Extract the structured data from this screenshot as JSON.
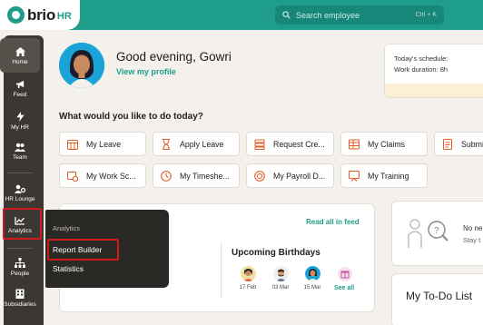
{
  "brand": {
    "name": "brio",
    "suffix": "HR",
    "color": "#1e9e8a"
  },
  "search": {
    "placeholder": "Search employee",
    "shortcut": "Ctrl + K"
  },
  "sidebar": {
    "items": [
      {
        "label": "Home",
        "icon": "home-icon",
        "active": true
      },
      {
        "label": "Feed",
        "icon": "megaphone-icon"
      },
      {
        "label": "My HR",
        "icon": "lightning-icon"
      },
      {
        "label": "Team",
        "icon": "team-icon"
      },
      {
        "label": "HR Lounge",
        "icon": "person-gear-icon"
      },
      {
        "label": "Analytics",
        "icon": "chart-icon",
        "highlighted": true
      },
      {
        "label": "People",
        "icon": "org-chart-icon"
      },
      {
        "label": "Subsidiaries",
        "icon": "building-icon"
      }
    ]
  },
  "greeting": {
    "text": "Good evening, Gowri",
    "profile_link": "View my profile"
  },
  "schedule": {
    "line1": "Today's schedule:",
    "line2": "Work duration: 8h"
  },
  "quick_actions": {
    "title": "What would you like to do today?",
    "row1": [
      "My Leave",
      "Apply Leave",
      "Request Cre...",
      "My Claims",
      "Submi"
    ],
    "row2": [
      "My Work Sc...",
      "My Timeshe...",
      "My Payroll D...",
      "My Training"
    ]
  },
  "feed": {
    "read_all": "Read all in feed"
  },
  "birthdays": {
    "title": "Upcoming Birthdays",
    "people": [
      {
        "date": "17 Feb"
      },
      {
        "date": "03 Mar"
      },
      {
        "date": "15 Mar"
      }
    ],
    "see_all": "See all"
  },
  "notifications": {
    "line1": "No ne",
    "line2": "Stay t"
  },
  "todo": {
    "title": "My To-Do List"
  },
  "analytics_menu": {
    "heading": "Analytics",
    "items": [
      "Report Builder",
      "Statistics"
    ]
  }
}
